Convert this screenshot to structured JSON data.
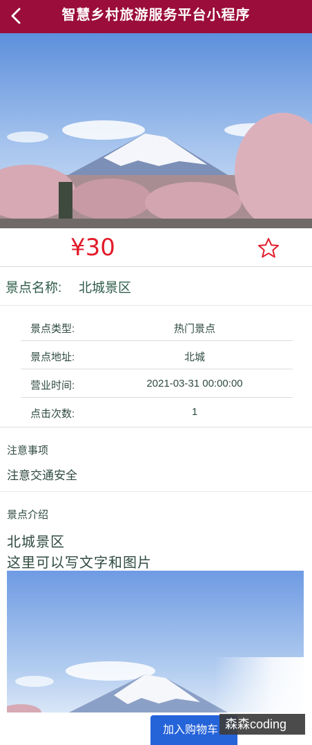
{
  "nav": {
    "title": "智慧乡村旅游服务平台小程序",
    "back_icon": "chevron-left-icon"
  },
  "hero": {
    "alt": "mountain-with-cherry-blossoms"
  },
  "price": {
    "value": "¥30"
  },
  "favorite": {
    "icon": "star-outline-icon",
    "color": "#e21b2a"
  },
  "spot": {
    "name_label": "景点名称:",
    "name_value": "北城景区"
  },
  "details": [
    {
      "label": "景点类型:",
      "value": "热门景点"
    },
    {
      "label": "景点地址:",
      "value": "北城"
    },
    {
      "label": "营业时间:",
      "value": "2021-03-31 00:00:00"
    },
    {
      "label": "点击次数:",
      "value": "1"
    }
  ],
  "notice": {
    "title": "注意事项",
    "text": "注意交通安全"
  },
  "intro": {
    "title": "景点介绍",
    "line1": "北城景区",
    "line2": "这里可以写文字和图片"
  },
  "actions": {
    "add_to_cart": "加入购物车"
  },
  "watermark": {
    "text": "森森coding"
  },
  "colors": {
    "nav_bg": "#9b0d3a",
    "price": "#e21b2a",
    "button": "#2563d9"
  }
}
